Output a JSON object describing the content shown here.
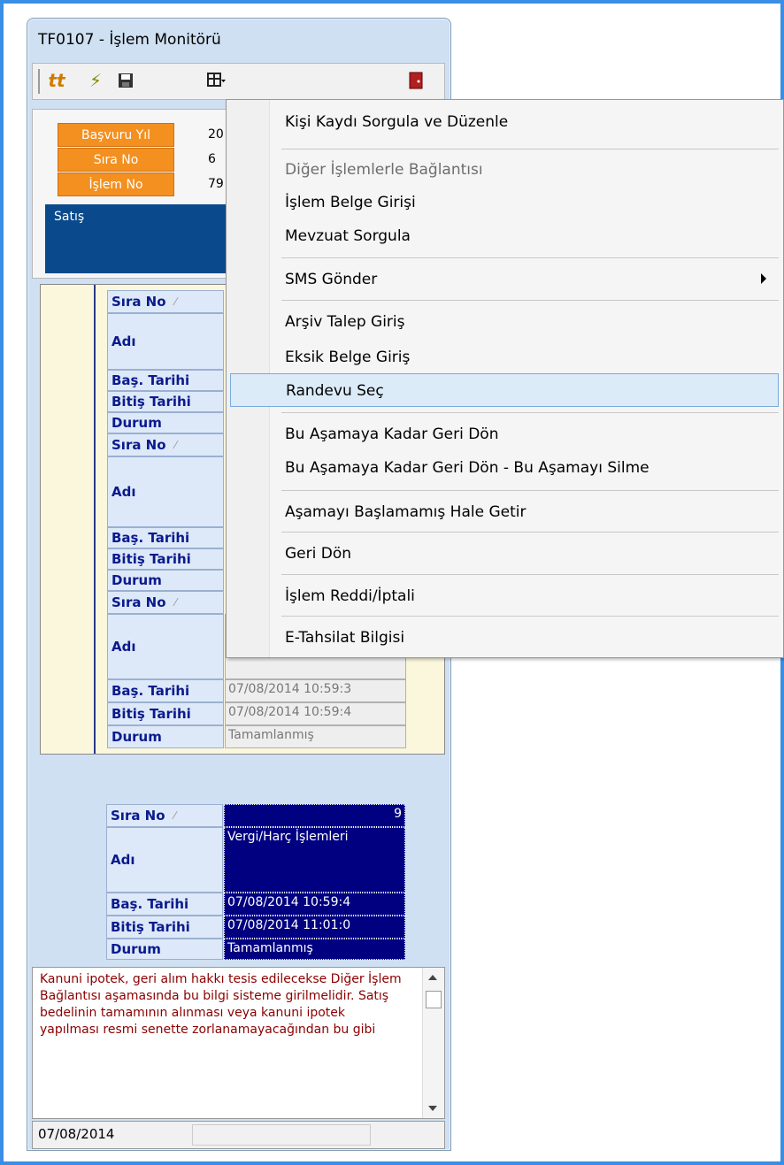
{
  "window": {
    "title": "TF0107 - İşlem Monitörü"
  },
  "toolbar": {
    "icons": [
      "tt-icon",
      "flash-icon",
      "save-icon",
      "layout-icon",
      "exit-icon"
    ]
  },
  "info": {
    "fields": [
      {
        "label": "Başvuru Yıl",
        "value": "20"
      },
      {
        "label": "Sıra No",
        "value": "6"
      },
      {
        "label": "İşlem No",
        "value": "79"
      }
    ],
    "type": "Satış"
  },
  "grid": {
    "labels": {
      "sira": "Sıra No",
      "adi": "Adı",
      "bas": "Baş. Tarihi",
      "bitis": "Bitiş Tarihi",
      "durum": "Durum"
    },
    "record3": {
      "adi": "Diğer İşlemlerle Bağlantısı",
      "bas": "07/08/2014 10:59:3",
      "bitis": "07/08/2014 10:59:4",
      "durum": "Tamamlanmış"
    },
    "record4": {
      "sira": "9",
      "adi": "Vergi/Harç İşlemleri",
      "bas": "07/08/2014 10:59:4",
      "bitis": "07/08/2014 11:01:0",
      "durum": "Tamamlanmış"
    }
  },
  "note": {
    "text": "Kanuni ipotek, geri alım hakkı tesis edilecekse Diğer İşlem Bağlantısı aşamasında bu bilgi sisteme girilmelidir. Satış bedelinin tamamının alınması veya kanuni ipotek yapılması resmi senette zorlanamayacağından bu gibi"
  },
  "status": {
    "date": "07/08/2014"
  },
  "menu": {
    "items": [
      {
        "label": "Kişi Kaydı Sorgula ve Düzenle"
      },
      {
        "label": "Diğer İşlemlerle Bağlantısı"
      },
      {
        "label": "İşlem Belge Girişi"
      },
      {
        "label": "Mevzuat Sorgula"
      },
      {
        "label": "SMS Gönder"
      },
      {
        "label": "Arşiv Talep Giriş"
      },
      {
        "label": "Eksik Belge Giriş"
      },
      {
        "label": "Randevu Seç"
      },
      {
        "label": "Bu Aşamaya Kadar Geri Dön"
      },
      {
        "label": "Bu Aşamaya Kadar Geri Dön - Bu Aşamayı Silme"
      },
      {
        "label": "Aşamayı Başlamamış Hale Getir"
      },
      {
        "label": "Geri Dön"
      },
      {
        "label": "İşlem Reddi/İptali"
      },
      {
        "label": "E-Tahsilat Bilgisi"
      }
    ]
  }
}
